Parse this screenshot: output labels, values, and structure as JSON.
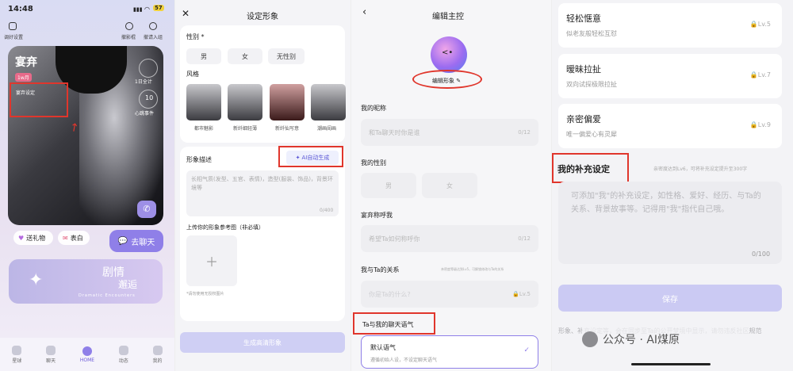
{
  "panel1": {
    "time": "14:48",
    "battery": "57",
    "top_left_label": "调好设置",
    "top_right_labels": [
      "撤影棍",
      "撤请入组"
    ],
    "character_name": "宴弃",
    "tag": "1w月",
    "tag_caption": "宴弃设定",
    "ring1_label": "1日全计",
    "ring2_num": "10",
    "ring2_label": "心跳事件",
    "gift_label": "送礼物",
    "like_label": "表白",
    "chat_button": "去聊天",
    "story_title": "剧情",
    "story_sub": "邂逅",
    "story_en": "Dramatic Encounters",
    "nav": [
      "星球",
      "聊天",
      "HOME",
      "动态",
      "我的"
    ]
  },
  "panel2": {
    "title": "设定形象",
    "gender_label": "性别 *",
    "genders": [
      "男",
      "女",
      "无性别"
    ],
    "style_label": "风格",
    "styles": [
      "都市魅影",
      "新纤细轻薄",
      "新纤仙写意",
      "潮画闺画"
    ],
    "desc_label": "形象描述",
    "ai_button": "AI自动生成",
    "desc_placeholder": "长相气质(发型、五官、表情)，造型(服装、饰品)，背景环境等",
    "desc_count": "0/400",
    "upload_label": "上传你的形象参考图（非必填）",
    "upload_hint": "*请勿使用无授权图片",
    "generate_button": "生成高清形象"
  },
  "panel3": {
    "title": "编辑主控",
    "edit_avatar": "编辑形象",
    "nickname_label": "我的昵称",
    "nickname_placeholder": "和Ta聊天时你是谁",
    "nickname_count": "0/12",
    "gender_label": "我的性别",
    "genders": [
      "男",
      "女"
    ],
    "call_label": "宴弃称呼我",
    "call_placeholder": "希望Ta如何称呼你",
    "call_count": "0/12",
    "relation_label": "我与Ta的关系",
    "relation_hint": "亲密度等级达到Lv5，可解锁修改与Ta的关系",
    "relation_placeholder": "你是Ta的什么?",
    "relation_lv": "Lv.5",
    "tone_label": "Ta与我的聊天语气",
    "tone_title": "默认语气",
    "tone_desc": "遵循初始人设，不设定聊天语气"
  },
  "panel4": {
    "rows": [
      {
        "title": "轻松惬意",
        "desc": "似老友般轻松互怼",
        "lv": "Lv.5"
      },
      {
        "title": "暧昧拉扯",
        "desc": "双向试探极限拉扯",
        "lv": "Lv.7"
      },
      {
        "title": "亲密偏爱",
        "desc": "唯一偏爱心有灵犀",
        "lv": "Lv.9"
      }
    ],
    "supp_label": "我的补充设定",
    "supp_hint": "亲密度达到Lv6，可将补充设定提升至300字",
    "supp_placeholder": "可添加\"我\"的补充设定，如性格、爱好、经历、与Ta的关系、背景故事等。记得用\"我\"指代自己哦。",
    "supp_count": "0/100",
    "save_button": "保存",
    "footer_text": "形象、补充设定等，会在同步至Ta的公开梦境中显示，请勿违反社区规范",
    "watermark": "公众号 · AI煤原"
  }
}
